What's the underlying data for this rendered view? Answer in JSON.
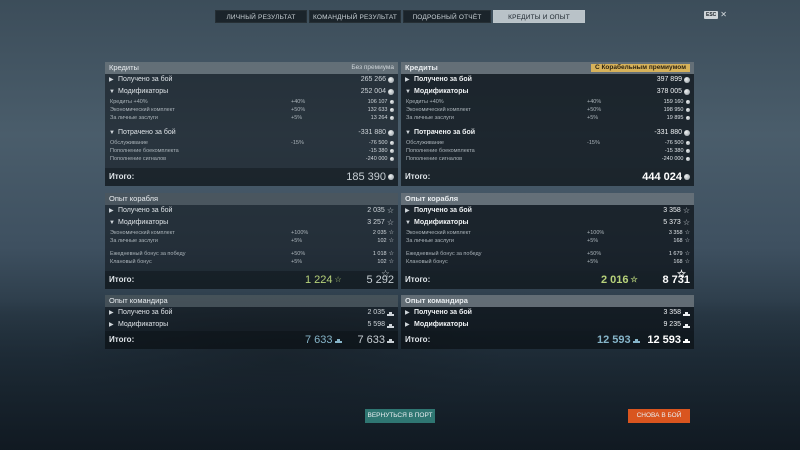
{
  "tabs": [
    {
      "label": "Личный результат",
      "active": false
    },
    {
      "label": "Командный результат",
      "active": false
    },
    {
      "label": "Подробный отчёт",
      "active": false
    },
    {
      "label": "Кредиты и опыт",
      "active": true
    }
  ],
  "esc": {
    "key": "ESC",
    "close": "✕"
  },
  "left": {
    "credits": {
      "title": "Кредиты",
      "badge": "Без премиума",
      "earned": {
        "label": "Получено за бой",
        "value": "265 266"
      },
      "mods": {
        "label": "Модификаторы",
        "value": "252 004"
      },
      "mod_rows": [
        {
          "label": "Кредиты +40%",
          "pct": "+40%",
          "value": "106 107"
        },
        {
          "label": "Экономический комплект",
          "pct": "+50%",
          "value": "132 633"
        },
        {
          "label": "За личные заслуги",
          "pct": "+5%",
          "value": "13 264"
        }
      ],
      "spent": {
        "label": "Потрачено за бой",
        "value": "-331 880"
      },
      "spent_rows": [
        {
          "label": "Обслуживание",
          "pct": "-15%",
          "value": "-76 500"
        },
        {
          "label": "Пополнение боекомплекта",
          "pct": "",
          "value": "-15 380"
        },
        {
          "label": "Пополнение сигналов",
          "pct": "",
          "value": "-240 000"
        }
      ],
      "total": {
        "label": "Итого:",
        "value": "185 390"
      }
    },
    "ship_xp": {
      "title": "Опыт корабля",
      "earned": {
        "label": "Получено за бой",
        "value": "2 035"
      },
      "mods": {
        "label": "Модификаторы",
        "value": "3 257"
      },
      "mod_rows": [
        {
          "label": "Экономический комплект",
          "pct": "+100%",
          "value": "2 035"
        },
        {
          "label": "За личные заслуги",
          "pct": "+5%",
          "value": "102"
        }
      ],
      "mod_rows2": [
        {
          "label": "Ежедневный бонус за победу",
          "pct": "+50%",
          "value": "1 018"
        },
        {
          "label": "Клановый бонус",
          "pct": "+5%",
          "value": "102"
        }
      ],
      "total": {
        "label": "Итого:",
        "free": "1 224",
        "value": "5 292"
      }
    },
    "cmd_xp": {
      "title": "Опыт командира",
      "earned": {
        "label": "Получено за бой",
        "value": "2 035"
      },
      "mods": {
        "label": "Модификаторы",
        "value": "5 598"
      },
      "total": {
        "label": "Итого:",
        "free": "7 633",
        "value": "7 633"
      }
    }
  },
  "right": {
    "credits": {
      "title": "Кредиты",
      "badge": "С Корабельным премиумом",
      "earned": {
        "label": "Получено за бой",
        "value": "397 899"
      },
      "mods": {
        "label": "Модификаторы",
        "value": "378 005"
      },
      "mod_rows": [
        {
          "label": "Кредиты +40%",
          "pct": "+40%",
          "value": "159 160"
        },
        {
          "label": "Экономический комплект",
          "pct": "+50%",
          "value": "198 950"
        },
        {
          "label": "За личные заслуги",
          "pct": "+5%",
          "value": "19 895"
        }
      ],
      "spent": {
        "label": "Потрачено за бой",
        "value": "-331 880"
      },
      "spent_rows": [
        {
          "label": "Обслуживание",
          "pct": "-15%",
          "value": "-76 500"
        },
        {
          "label": "Пополнение боекомплекта",
          "pct": "",
          "value": "-15 380"
        },
        {
          "label": "Пополнение сигналов",
          "pct": "",
          "value": "-240 000"
        }
      ],
      "total": {
        "label": "Итого:",
        "value": "444 024"
      }
    },
    "ship_xp": {
      "title": "Опыт корабля",
      "earned": {
        "label": "Получено за бой",
        "value": "3 358"
      },
      "mods": {
        "label": "Модификаторы",
        "value": "5 373"
      },
      "mod_rows": [
        {
          "label": "Экономический комплект",
          "pct": "+100%",
          "value": "3 358"
        },
        {
          "label": "За личные заслуги",
          "pct": "+5%",
          "value": "168"
        }
      ],
      "mod_rows2": [
        {
          "label": "Ежедневный бонус за победу",
          "pct": "+50%",
          "value": "1 679"
        },
        {
          "label": "Клановый бонус",
          "pct": "+5%",
          "value": "168"
        }
      ],
      "total": {
        "label": "Итого:",
        "free": "2 016",
        "value": "8 731"
      }
    },
    "cmd_xp": {
      "title": "Опыт командира",
      "earned": {
        "label": "Получено за бой",
        "value": "3 358"
      },
      "mods": {
        "label": "Модификаторы",
        "value": "9 235"
      },
      "total": {
        "label": "Итого:",
        "free": "12 593",
        "value": "12 593"
      }
    }
  },
  "buttons": {
    "port": "Вернуться в порт",
    "battle": "Снова в бой"
  }
}
